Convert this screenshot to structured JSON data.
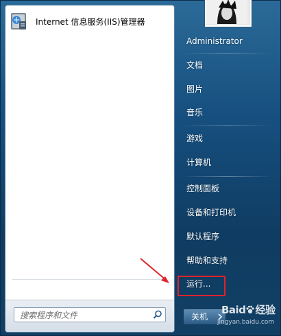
{
  "programs": [
    {
      "label": "Internet 信息服务(IIS)管理器",
      "icon": "iis-manager-icon"
    }
  ],
  "search": {
    "placeholder": "搜索程序和文件",
    "icon": "search-icon"
  },
  "right_menu": {
    "username": "Administrator",
    "items": [
      "文档",
      "图片",
      "音乐",
      "游戏",
      "计算机",
      "控制面板",
      "设备和打印机",
      "默认程序",
      "帮助和支持",
      "运行..."
    ]
  },
  "shutdown": {
    "label": "关机"
  },
  "watermark": {
    "main": "Baid",
    "main2": "经验",
    "sub": "jingyan.baidu.com"
  },
  "colors": {
    "highlight": "#e0232a",
    "menu_blue": "#164f7f"
  }
}
